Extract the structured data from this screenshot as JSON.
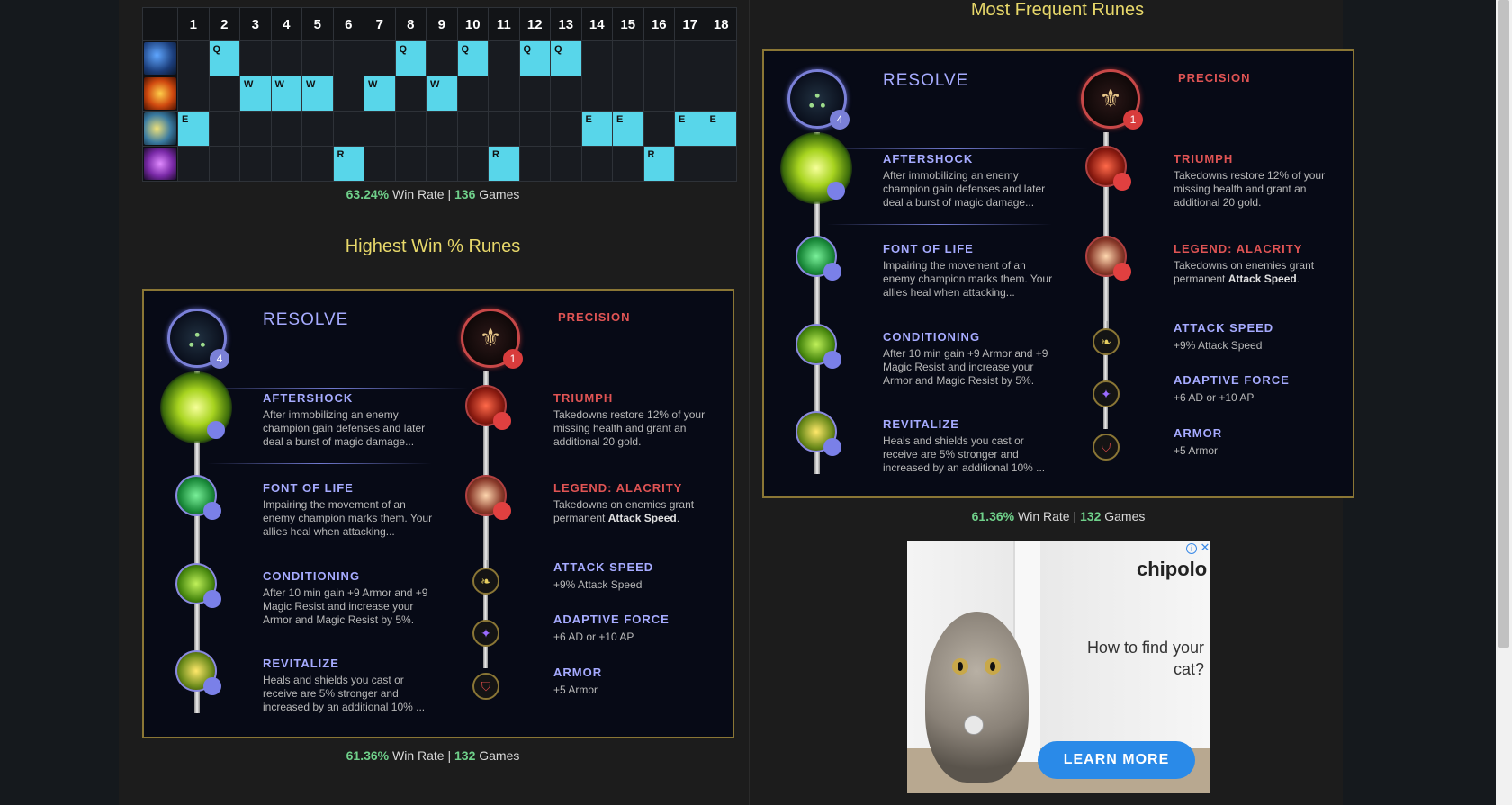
{
  "skill_order": {
    "levels": [
      "1",
      "2",
      "3",
      "4",
      "5",
      "6",
      "7",
      "8",
      "9",
      "10",
      "11",
      "12",
      "13",
      "14",
      "15",
      "16",
      "17",
      "18"
    ],
    "rows": [
      {
        "skill": "Q",
        "icon": "q-ability-icon",
        "levels": [
          2,
          8,
          10,
          12,
          13
        ]
      },
      {
        "skill": "W",
        "icon": "w-ability-icon",
        "levels": [
          3,
          4,
          5,
          7,
          9
        ]
      },
      {
        "skill": "E",
        "icon": "e-ability-icon",
        "levels": [
          1,
          14,
          15,
          17,
          18
        ]
      },
      {
        "skill": "R",
        "icon": "r-ability-icon",
        "levels": [
          6,
          11,
          16
        ]
      }
    ],
    "win_rate": "63.24%",
    "win_rate_label": "Win Rate |",
    "games": "136",
    "games_label": "Games"
  },
  "highest_win": {
    "title": "Highest Win % Runes",
    "win_rate": "61.36%",
    "win_rate_label": "Win Rate |",
    "games": "132",
    "games_label": "Games"
  },
  "most_frequent": {
    "title": "Most Frequent Runes",
    "win_rate": "61.36%",
    "win_rate_label": "Win Rate |",
    "games": "132",
    "games_label": "Games"
  },
  "runes": {
    "primary_tree": "RESOLVE",
    "primary_badge": "4",
    "secondary_tree": "PRECISION",
    "secondary_badge": "1",
    "primary": [
      {
        "name": "AFTERSHOCK",
        "desc": "After immobilizing an enemy champion gain defenses and later deal a burst of magic damage...",
        "icon": "aftershock-icon"
      },
      {
        "name": "FONT OF LIFE",
        "desc": "Impairing the movement of an enemy champion marks them. Your allies heal when attacking...",
        "icon": "font-of-life-icon"
      },
      {
        "name": "CONDITIONING",
        "desc": "After 10 min gain +9 Armor and +9 Magic Resist and increase your Armor and Magic Resist by 5%.",
        "icon": "conditioning-icon"
      },
      {
        "name": "REVITALIZE",
        "desc": "Heals and shields you cast or receive are 5% stronger and increased by an additional 10% ...",
        "icon": "revitalize-icon"
      }
    ],
    "secondary": [
      {
        "name": "TRIUMPH",
        "desc": "Takedowns restore 12% of your missing health and grant an additional 20 gold.",
        "icon": "triumph-icon"
      },
      {
        "name": "LEGEND: ALACRITY",
        "desc_prefix": "Takedowns on enemies grant permanent",
        "desc_bold": "Attack Speed",
        "desc_suffix": ".",
        "icon": "legend-alacrity-icon"
      }
    ],
    "shards": [
      {
        "name": "ATTACK SPEED",
        "desc": "+9% Attack Speed",
        "icon": "attack-speed-shard-icon"
      },
      {
        "name": "ADAPTIVE FORCE",
        "desc": "+6 AD or +10 AP",
        "icon": "adaptive-force-shard-icon"
      },
      {
        "name": "ARMOR",
        "desc": "+5 Armor",
        "icon": "armor-shard-icon"
      }
    ]
  },
  "ad": {
    "brand": "chipolo",
    "headline": "How to find your cat?",
    "cta": "LEARN MORE",
    "info": "i",
    "close": "✕"
  },
  "colors": {
    "skill_fill": "#58d6ea",
    "title_gold": "#e8d86a",
    "resolve_blue": "#a6abff",
    "precision_red": "#e05454",
    "win_green": "#6fd08a"
  }
}
